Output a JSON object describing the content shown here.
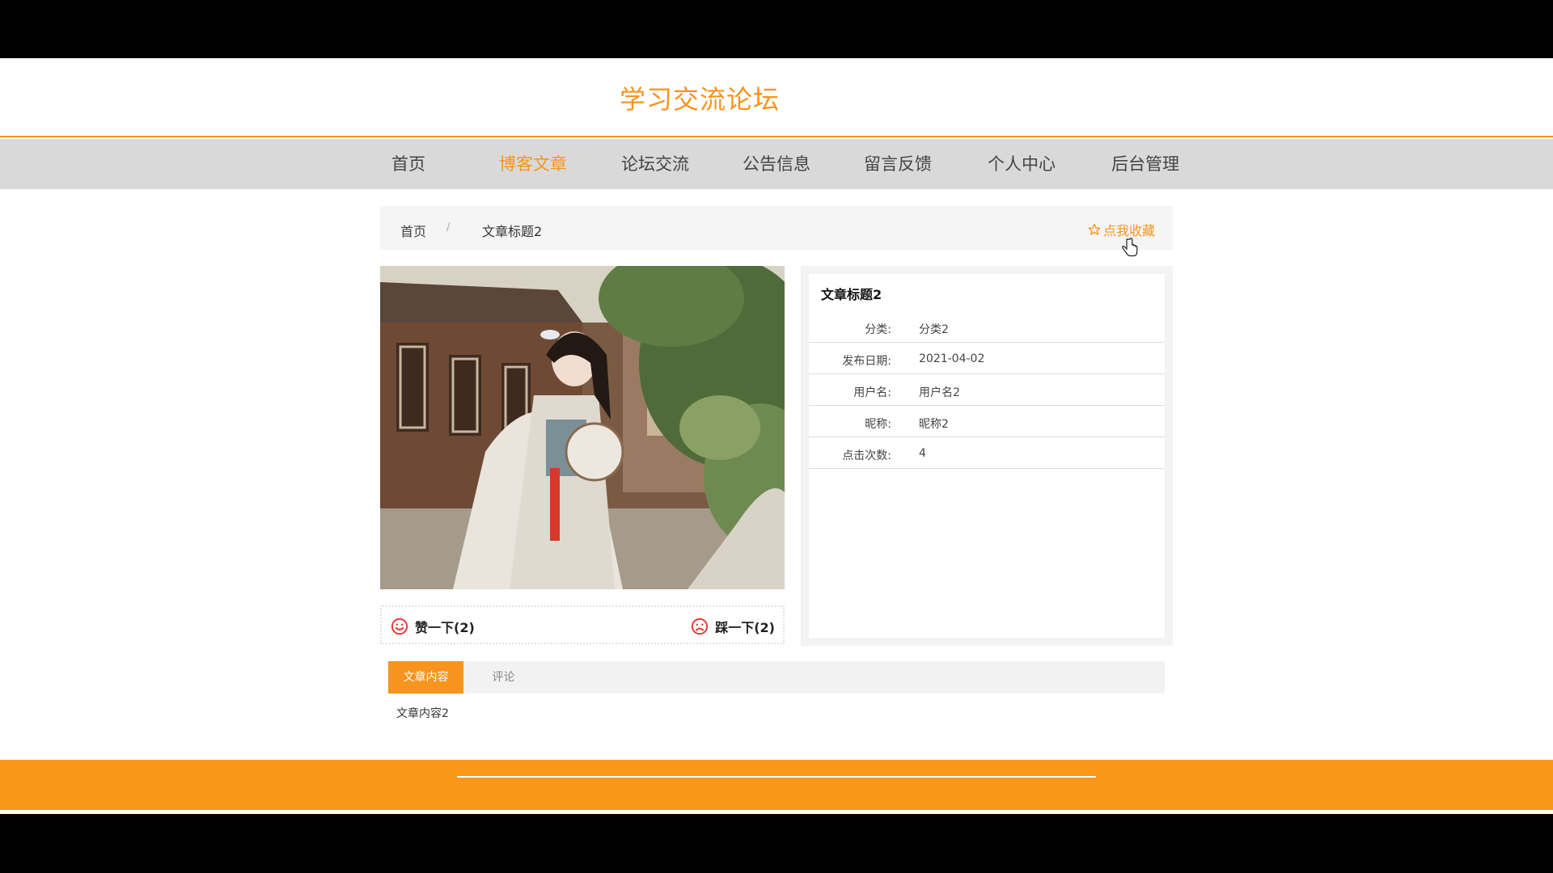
{
  "site": {
    "title": "学习交流论坛"
  },
  "nav": {
    "items": [
      {
        "label": "首页"
      },
      {
        "label": "博客文章",
        "active": true
      },
      {
        "label": "论坛交流"
      },
      {
        "label": "公告信息"
      },
      {
        "label": "留言反馈"
      },
      {
        "label": "个人中心"
      },
      {
        "label": "后台管理"
      }
    ]
  },
  "breadcrumb": {
    "home": "首页",
    "separator": "/",
    "current": "文章标题2"
  },
  "favorite": {
    "label": "点我收藏",
    "icon": "star-outline-icon"
  },
  "votes": {
    "like": {
      "label": "赞一下(2)",
      "icon": "smile-icon"
    },
    "dislike": {
      "label": "踩一下(2)",
      "icon": "frown-icon"
    }
  },
  "article": {
    "title": "文章标题2",
    "fields": [
      {
        "label": "分类:",
        "value": "分类2"
      },
      {
        "label": "发布日期:",
        "value": "2021-04-02"
      },
      {
        "label": "用户名:",
        "value": "用户名2"
      },
      {
        "label": "昵称:",
        "value": "昵称2"
      },
      {
        "label": "点击次数:",
        "value": "4"
      }
    ]
  },
  "tabs": {
    "content": "文章内容",
    "comments": "评论"
  },
  "content": {
    "text": "文章内容2"
  },
  "colors": {
    "accent": "#f7941d",
    "nav_bg": "#d9d9d9",
    "footer": "#f7981a",
    "vote_icon": "#e03030"
  }
}
